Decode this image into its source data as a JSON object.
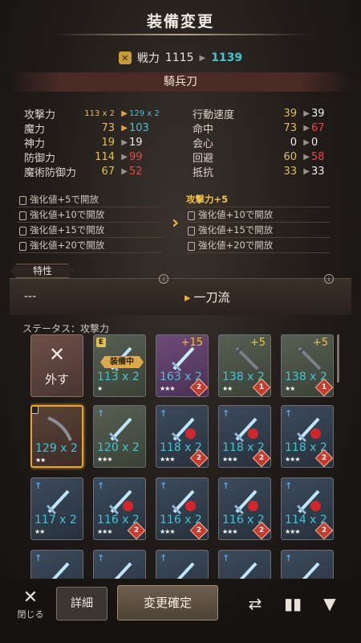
{
  "header": {
    "title": "装備変更"
  },
  "power": {
    "label": "戦力",
    "old": "1115",
    "new": "1139"
  },
  "weapon": {
    "name": "騎兵刀"
  },
  "stats_left": [
    {
      "label": "攻撃力",
      "old": "113 x 2",
      "new": "129 x 2",
      "up": true
    },
    {
      "label": "魔力",
      "old": "73",
      "new": "103",
      "up": true
    },
    {
      "label": "神力",
      "old": "19",
      "new": "19",
      "up": false
    },
    {
      "label": "防御力",
      "old": "114",
      "new": "99",
      "up": false
    },
    {
      "label": "魔術防御力",
      "old": "67",
      "new": "52",
      "up": false
    }
  ],
  "stats_right": [
    {
      "label": "行動速度",
      "old": "39",
      "new": "39"
    },
    {
      "label": "命中",
      "old": "73",
      "new": "67"
    },
    {
      "label": "会心",
      "old": "0",
      "new": "0"
    },
    {
      "label": "回避",
      "old": "60",
      "new": "58"
    },
    {
      "label": "抵抗",
      "old": "33",
      "new": "33"
    }
  ],
  "unlocks_left": [
    "強化値+5で開放",
    "強化値+10で開放",
    "強化値+15で開放",
    "強化値+20で開放"
  ],
  "unlocks_right": [
    "攻撃力+5",
    "強化値+10で開放",
    "強化値+15で開放",
    "強化値+20で開放"
  ],
  "trait": {
    "label": "特性",
    "old": "---",
    "new": "一刀流"
  },
  "status_filter": "ステータス：攻撃力",
  "grid": {
    "unequip_label": "外す",
    "equipped_tag": "装備中",
    "equipped_badge": "E",
    "items": [
      {
        "value": "113 x 2",
        "stars": "★",
        "plus": "",
        "badge": ""
      },
      {
        "value": "163 x 2",
        "stars": "★★★",
        "plus": "+15",
        "badge": "2"
      },
      {
        "value": "138 x 2",
        "stars": "★★",
        "plus": "+5",
        "badge": "1"
      },
      {
        "value": "138 x 2",
        "stars": "★★",
        "plus": "+5",
        "badge": "1"
      },
      {
        "value": "129 x 2",
        "stars": "★★",
        "plus": "",
        "badge": ""
      },
      {
        "value": "120 x 2",
        "stars": "★★★",
        "plus": "",
        "badge": ""
      },
      {
        "value": "118 x 2",
        "stars": "★★★",
        "plus": "",
        "badge": "2"
      },
      {
        "value": "118 x 2",
        "stars": "★★★",
        "plus": "",
        "badge": "2"
      },
      {
        "value": "118 x 2",
        "stars": "★★★",
        "plus": "",
        "badge": "2"
      },
      {
        "value": "117 x 2",
        "stars": "★★",
        "plus": "",
        "badge": ""
      },
      {
        "value": "116 x 2",
        "stars": "★★★",
        "plus": "",
        "badge": "2"
      },
      {
        "value": "116 x 2",
        "stars": "★★★",
        "plus": "",
        "badge": "2"
      },
      {
        "value": "116 x 2",
        "stars": "★★★",
        "plus": "",
        "badge": "2"
      },
      {
        "value": "114 x 2",
        "stars": "★★★",
        "plus": "",
        "badge": "2"
      }
    ]
  },
  "bottom": {
    "close_label": "閉じる",
    "detail_label": "詳細",
    "confirm_label": "変更確定"
  },
  "icons": {
    "power": "crossed-swords-icon",
    "refresh": "swap-icon",
    "sort": "sort-bars-icon",
    "filter": "filter-funnel-icon"
  }
}
